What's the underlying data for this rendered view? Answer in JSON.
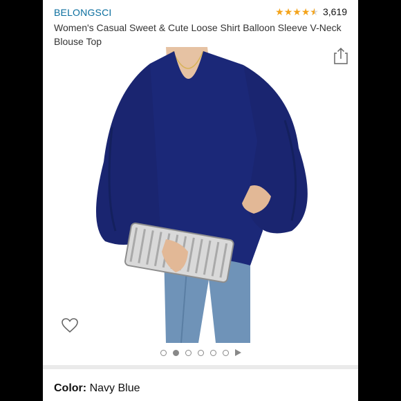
{
  "product": {
    "brand": "BELONGSCI",
    "rating": 4.5,
    "review_count": "3,619",
    "title": "Women's Casual Sweet & Cute Loose Shirt Balloon Sleeve V-Neck Blouse Top"
  },
  "gallery": {
    "total_images": 6,
    "active_index": 1,
    "has_video": true
  },
  "variant": {
    "label": "Color:",
    "value": "Navy Blue"
  },
  "colors": {
    "brand_link": "#0a6e9e",
    "star": "#f4a41c",
    "blouse": "#1b2878",
    "background": "#000000"
  },
  "icons": [
    "share-icon",
    "heart-icon",
    "play-icon"
  ]
}
